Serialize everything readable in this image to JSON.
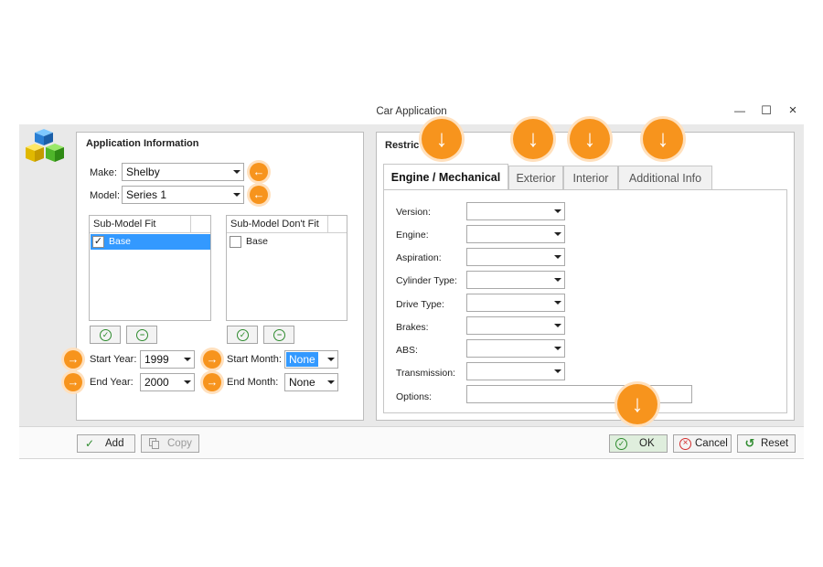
{
  "window": {
    "title": "Car Application",
    "minimize_glyph": "—",
    "maximize_glyph": "☐",
    "close_glyph": "×"
  },
  "app_info": {
    "title": "Application Information",
    "make_label": "Make:",
    "make_value": "Shelby",
    "model_label": "Model:",
    "model_value": "Series 1",
    "fit_header": "Sub-Model Fit",
    "fit_items": [
      {
        "label": "Base",
        "checked": true
      }
    ],
    "dont_fit_header": "Sub-Model Don't Fit",
    "dont_fit_items": [
      {
        "label": "Base",
        "checked": false
      }
    ],
    "start_year_label": "Start Year:",
    "start_year_value": "1999",
    "end_year_label": "End Year:",
    "end_year_value": "2000",
    "start_month_label": "Start Month:",
    "start_month_value": "None",
    "end_month_label": "End Month:",
    "end_month_value": "None"
  },
  "restrictions": {
    "title": "Restric",
    "tabs": [
      "Engine / Mechanical",
      "Exterior",
      "Interior",
      "Additional Info"
    ],
    "active_tab": 0,
    "fields": [
      {
        "label": "Version:",
        "value": ""
      },
      {
        "label": "Engine:",
        "value": ""
      },
      {
        "label": "Aspiration:",
        "value": ""
      },
      {
        "label": "Cylinder Type:",
        "value": ""
      },
      {
        "label": "Drive Type:",
        "value": ""
      },
      {
        "label": "Brakes:",
        "value": ""
      },
      {
        "label": "ABS:",
        "value": ""
      },
      {
        "label": "Transmission:",
        "value": ""
      }
    ],
    "options_label": "Options:",
    "options_value": ""
  },
  "footer": {
    "add_label": "Add",
    "copy_label": "Copy",
    "ok_label": "OK",
    "cancel_label": "Cancel",
    "reset_label": "Reset"
  },
  "icons": {
    "check": "✓",
    "remove": "−",
    "arrow_left": "←",
    "arrow_right": "→",
    "arrow_down": "↓"
  },
  "colors": {
    "marker": "#f7941d",
    "selection": "#3399ff",
    "ok_green": "#2e8b2e",
    "cancel_red": "#d32f2f"
  }
}
